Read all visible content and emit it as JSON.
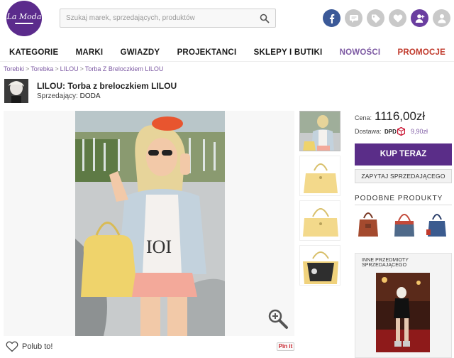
{
  "header": {
    "logo_text": "La Moda",
    "search_placeholder": "Szukaj marek, sprzedających, produktów",
    "icons": [
      "facebook-icon",
      "chat-icon",
      "tag-icon",
      "heart-icon",
      "add-user-icon",
      "user-icon"
    ]
  },
  "nav": {
    "items": [
      "KATEGORIE",
      "MARKI",
      "GWIAZDY",
      "PROJEKTANCI",
      "SKLEPY I BUTIKI",
      "NOWOŚCI",
      "PROMOCJE"
    ]
  },
  "breadcrumb": [
    "Torebki",
    "Torebka",
    "LILOU",
    "Torba Z Breloczkiem LILOU"
  ],
  "product": {
    "title": "LILOU: Torba z breloczkiem LILOU",
    "seller_label": "Sprzedający:",
    "seller_name": "DODA",
    "price_label": "Cena:",
    "price": "1116,00zł",
    "shipping_label": "Dostawa:",
    "shipping_carrier": "DPD",
    "shipping_price": "9,90zł",
    "buy_button": "KUP TERAZ",
    "ask_button": "ZAPYTAJ SPRZEDAJĄCEGO",
    "like_label": "Polub to!",
    "pinit_label": "Pin it"
  },
  "similar": {
    "title": "PODOBNE PRODUKTY"
  },
  "other_items": {
    "title": "INNE PRZEDMIOTY SPRZEDAJĄCEGO"
  },
  "colors": {
    "brand_purple": "#5a2d88",
    "promo_red": "#c0392b",
    "nowosci_purple": "#7d5aa3",
    "facebook_blue": "#3b5998"
  }
}
